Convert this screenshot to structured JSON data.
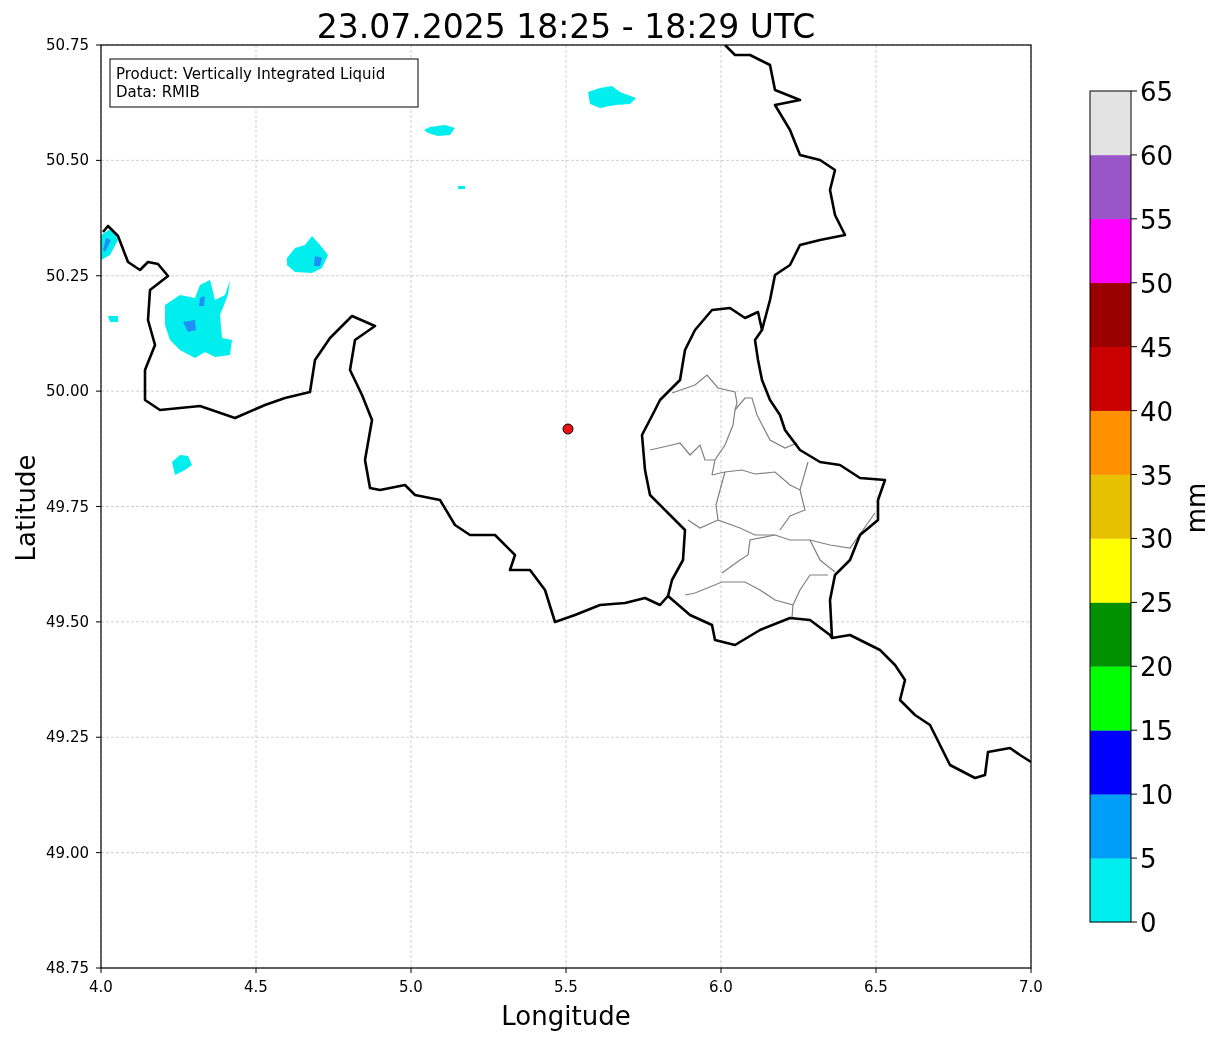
{
  "title": "23.07.2025 18:25 - 18:29 UTC",
  "info_box": {
    "lines": [
      "Product: Vertically Integrated Liquid",
      "Data: RMIB"
    ]
  },
  "map": {
    "xlabel": "Longitude",
    "ylabel": "Latitude",
    "xticks": [
      "4.0",
      "4.5",
      "5.0",
      "5.5",
      "6.0",
      "6.5",
      "7.0"
    ],
    "yticks": [
      "50.75",
      "50.50",
      "50.25",
      "50.00",
      "49.75",
      "49.50",
      "49.25",
      "49.00",
      "48.75"
    ]
  },
  "colorbar": {
    "label": "mm",
    "ticks": [
      "65",
      "60",
      "55",
      "50",
      "45",
      "40",
      "35",
      "30",
      "25",
      "20",
      "15",
      "10",
      "5",
      "0"
    ],
    "bins": [
      {
        "color": "#00eeee"
      },
      {
        "color": "#009ef9"
      },
      {
        "color": "#0000ff"
      },
      {
        "color": "#00ff00"
      },
      {
        "color": "#009000"
      },
      {
        "color": "#ffff00"
      },
      {
        "color": "#e7c000"
      },
      {
        "color": "#ff9000"
      },
      {
        "color": "#c80000"
      },
      {
        "color": "#9a0000"
      },
      {
        "color": "#ff00ff"
      },
      {
        "color": "#9a55c9"
      },
      {
        "color": "#e3e3e3"
      }
    ]
  }
}
